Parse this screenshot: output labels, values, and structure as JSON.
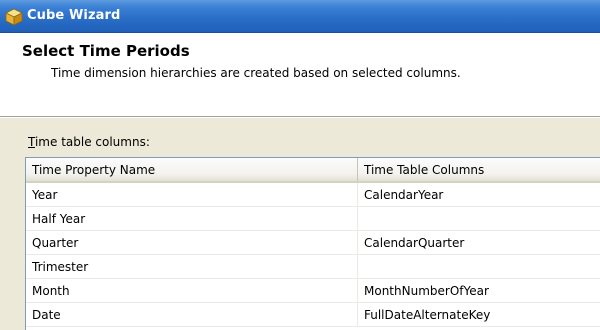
{
  "window": {
    "title": "Cube Wizard",
    "icon": "cube-icon"
  },
  "header": {
    "heading": "Select Time Periods",
    "subheading": "Time dimension hierarchies are created based on selected columns."
  },
  "grid": {
    "label_mnemonic": "T",
    "label_rest": "ime table columns:",
    "columns": [
      "Time Property Name",
      "Time Table Columns"
    ],
    "rows": [
      {
        "property": "Year",
        "column": "CalendarYear"
      },
      {
        "property": "Half Year",
        "column": ""
      },
      {
        "property": "Quarter",
        "column": "CalendarQuarter"
      },
      {
        "property": "Trimester",
        "column": ""
      },
      {
        "property": "Month",
        "column": "MonthNumberOfYear"
      },
      {
        "property": "Date",
        "column": "FullDateAlternateKey"
      }
    ]
  },
  "colors": {
    "titlebar": "#2b6fc7",
    "dialog_bg": "#ece9d8",
    "grid_border": "#7f9db9"
  }
}
